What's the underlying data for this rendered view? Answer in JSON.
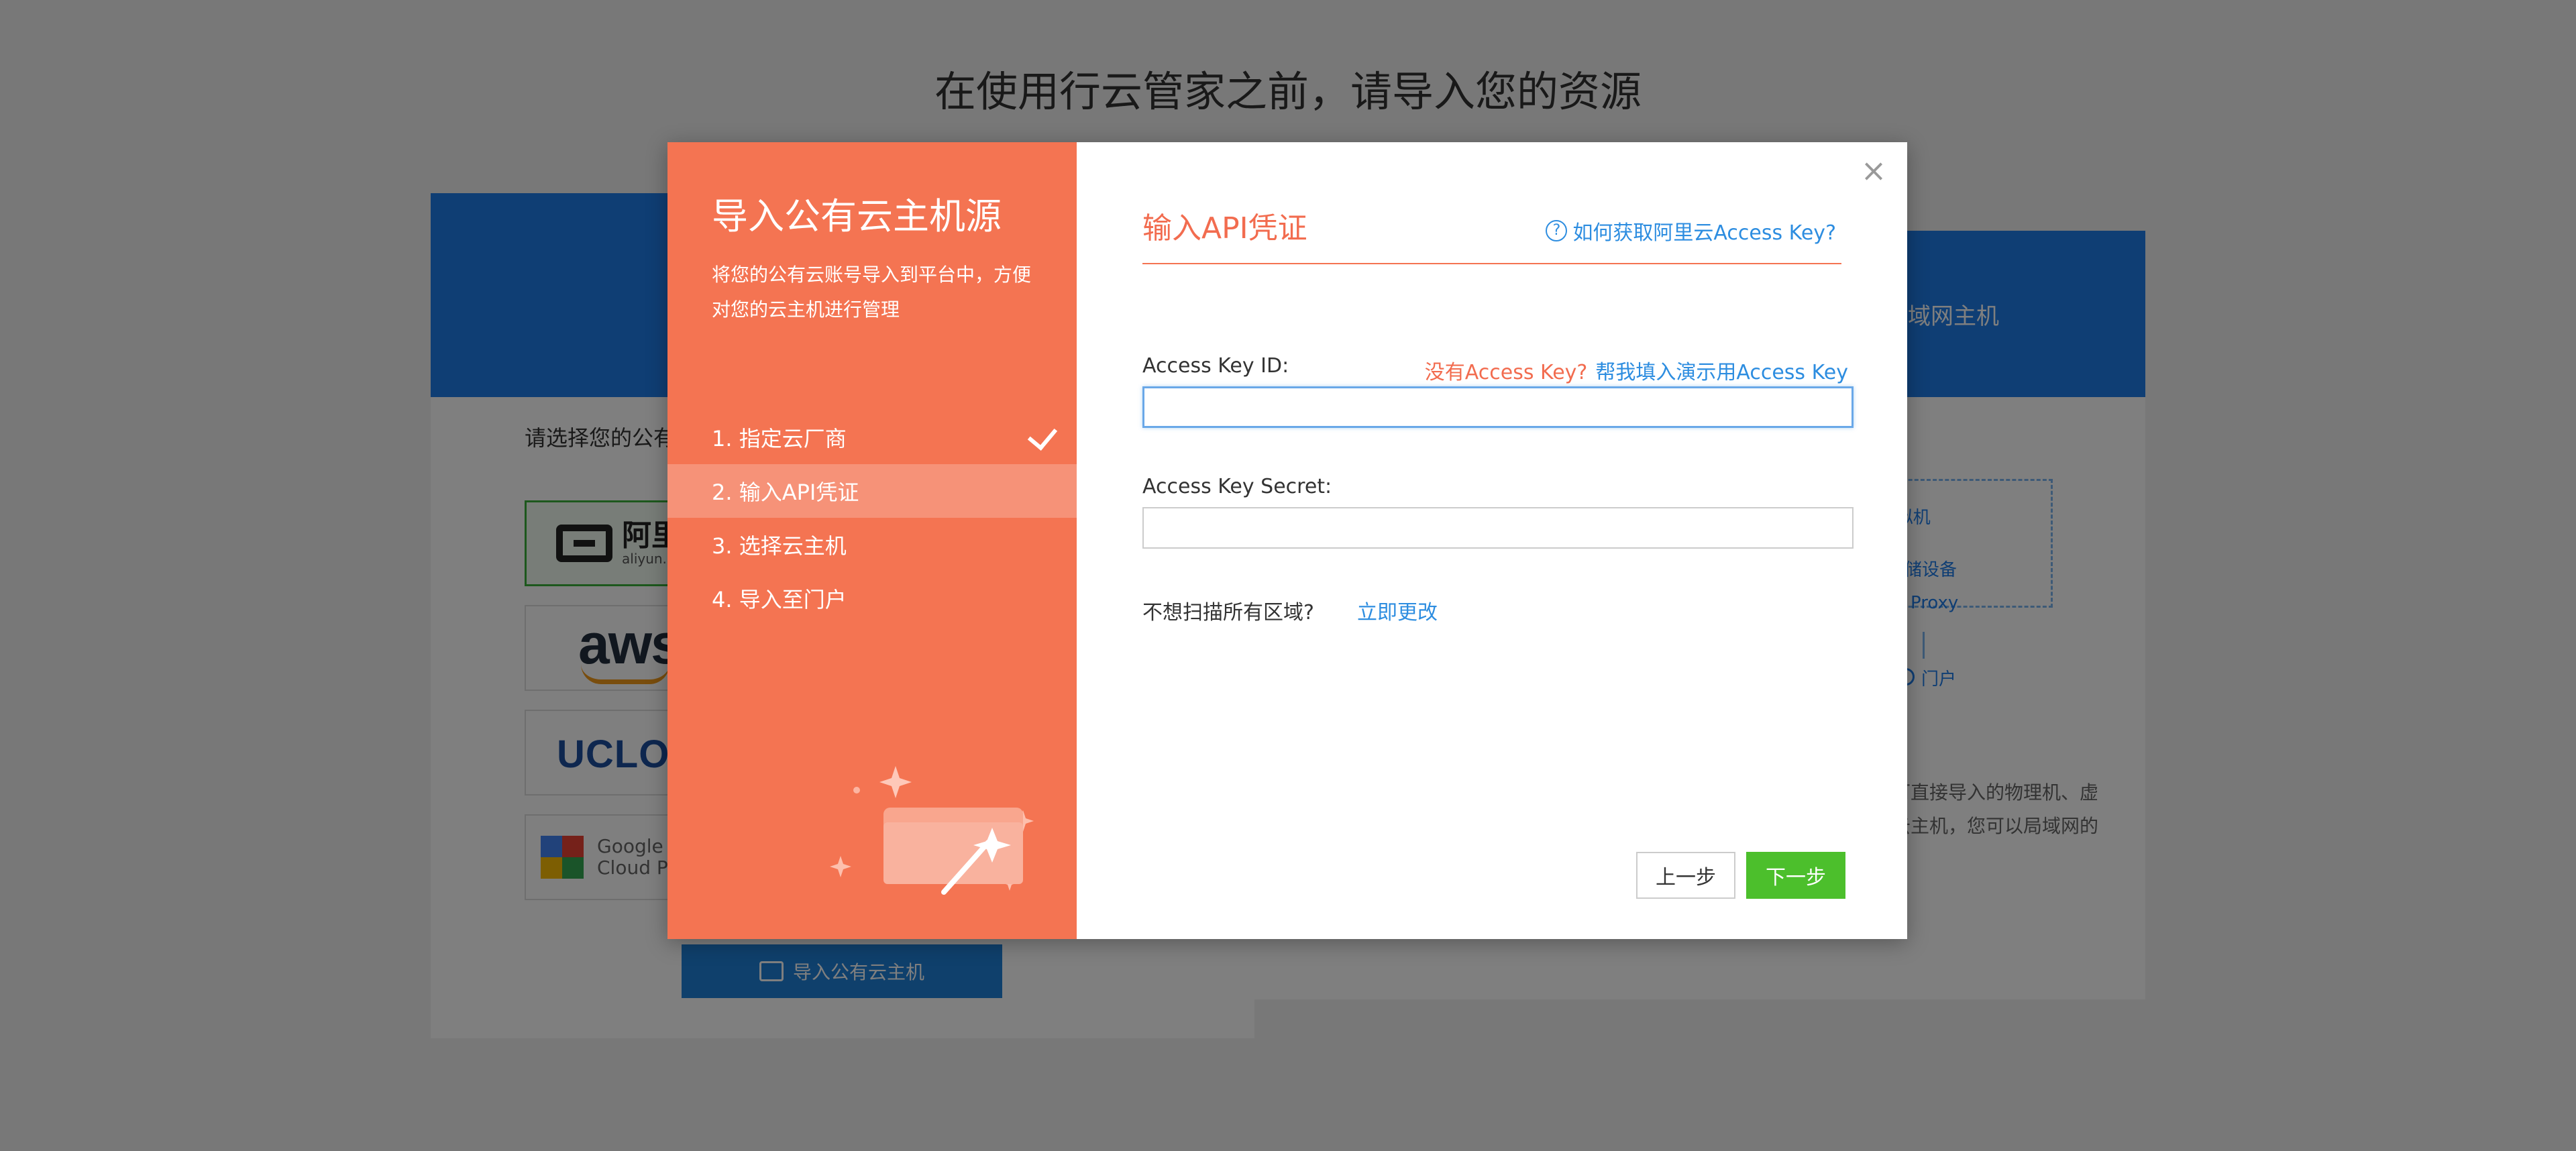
{
  "background": {
    "page_title": "在使用行云管家之前，请导入您的资源",
    "left_card": {
      "prompt": "请选择您的公有",
      "providers": [
        {
          "name": "aliyun",
          "logo_cn": "阿里",
          "logo_en": "aliyun.c"
        },
        {
          "name": "aws",
          "logo_text": "aws"
        },
        {
          "name": "ucloud",
          "logo_text": "UCLOU"
        },
        {
          "name": "google-cloud",
          "logo_line1": "Google",
          "logo_line2": "Cloud Plat"
        }
      ],
      "import_button": "导入公有云主机"
    },
    "right_card": {
      "header": "局域网主机",
      "diagram": {
        "vm_label": "理机/虚拟机",
        "storage_label": "存储设备",
        "proxy_label": "Proxy",
        "portal_label": "门户"
      },
      "desc_line1": "可直接导入的物理机、虚",
      "desc_line2": "云主机，您可以局域网的"
    },
    "colors": {
      "header_blue": "#1e7ce8",
      "selected_green": "#3bb13b"
    }
  },
  "modal": {
    "left": {
      "title": "导入公有云主机源",
      "description": "将您的公有云账号导入到平台中，方便对您的云主机进行管理",
      "steps": [
        {
          "label": "1. 指定云厂商",
          "done": true
        },
        {
          "label": "2. 输入API凭证",
          "active": true
        },
        {
          "label": "3. 选择云主机"
        },
        {
          "label": "4. 导入至门户"
        }
      ],
      "accent": "#f47452"
    },
    "close_symbol": "×",
    "section_title": "输入API凭证",
    "help_icon": "?",
    "help_link": "如何获取阿里云Access Key?",
    "no_key_text": "没有Access Key?",
    "demo_link": "帮我填入演示用Access Key",
    "access_key_id_label": "Access Key ID:",
    "access_key_id_value": "",
    "access_key_secret_label": "Access Key Secret:",
    "access_key_secret_value": "",
    "region_question": "不想扫描所有区域?",
    "region_link": "立即更改",
    "prev_button": "上一步",
    "next_button": "下一步",
    "next_color": "#4cbf2c"
  }
}
